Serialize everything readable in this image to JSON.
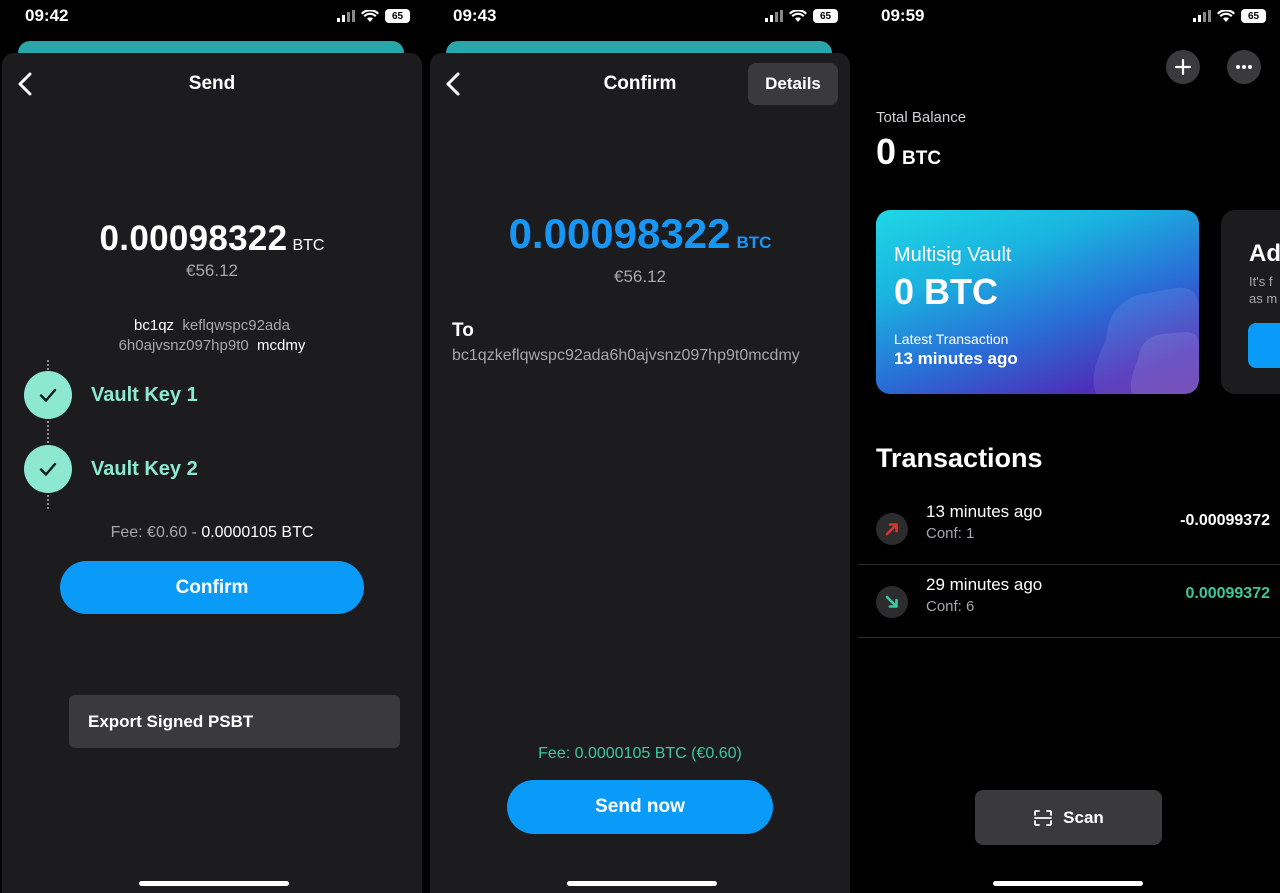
{
  "panels": [
    {
      "status": {
        "time": "09:42",
        "battery": "65"
      },
      "title": "Send",
      "amount": "0.00098322",
      "unit": "BTC",
      "fiat": "€56.12",
      "address": {
        "line1_a": "bc1qz",
        "line1_b": "keflqwspc92ada",
        "line2_a": "6h0ajvsnz097hp9t0",
        "line2_b": "mcdmy"
      },
      "keys": [
        {
          "label": "Vault Key 1"
        },
        {
          "label": "Vault Key 2"
        }
      ],
      "fee": {
        "prefix": "Fee: €0.60 - ",
        "btc": "0.0000105 BTC"
      },
      "confirm_label": "Confirm",
      "export_label": "Export Signed PSBT"
    },
    {
      "status": {
        "time": "09:43",
        "battery": "65"
      },
      "title": "Confirm",
      "details_label": "Details",
      "amount": "0.00098322",
      "unit": "BTC",
      "fiat": "€56.12",
      "to_label": "To",
      "to_address": "bc1qzkeflqwspc92ada6h0ajvsnz097hp9t0mcdmy",
      "fee": "Fee: 0.0000105 BTC (€0.60)",
      "send_label": "Send now"
    },
    {
      "status": {
        "time": "09:59",
        "battery": "65"
      },
      "total_balance_label": "Total Balance",
      "total_balance_value": "0",
      "total_balance_unit": "BTC",
      "vault_card": {
        "name": "Multisig Vault",
        "balance": "0 BTC",
        "latest_label": "Latest Transaction",
        "latest_time": "13 minutes ago"
      },
      "second_card": {
        "title": "Ad",
        "line1": "It's f",
        "line2": "as m"
      },
      "transactions_heading": "Transactions",
      "transactions": [
        {
          "time": "13 minutes ago",
          "conf": "Conf: 1",
          "amount": "-0.00099372",
          "direction": "outgoing"
        },
        {
          "time": "29 minutes ago",
          "conf": "Conf: 6",
          "amount": "0.00099372",
          "direction": "incoming"
        }
      ],
      "scan_label": "Scan"
    }
  ],
  "colors": {
    "accent_blue": "#0a9bf8",
    "mint": "#8de8d2",
    "fee_green": "#3fc6a0",
    "outgoing_red": "#e0322b",
    "incoming_teal": "#3fc6a0",
    "sheet_bg": "#1c1c1e"
  },
  "icons": {
    "back": "chevron-left-icon",
    "check": "check-icon",
    "plus": "plus-icon",
    "more": "more-horizontal-icon",
    "scan": "scan-icon",
    "outgoing": "arrow-up-right-icon",
    "incoming": "arrow-down-right-icon"
  }
}
